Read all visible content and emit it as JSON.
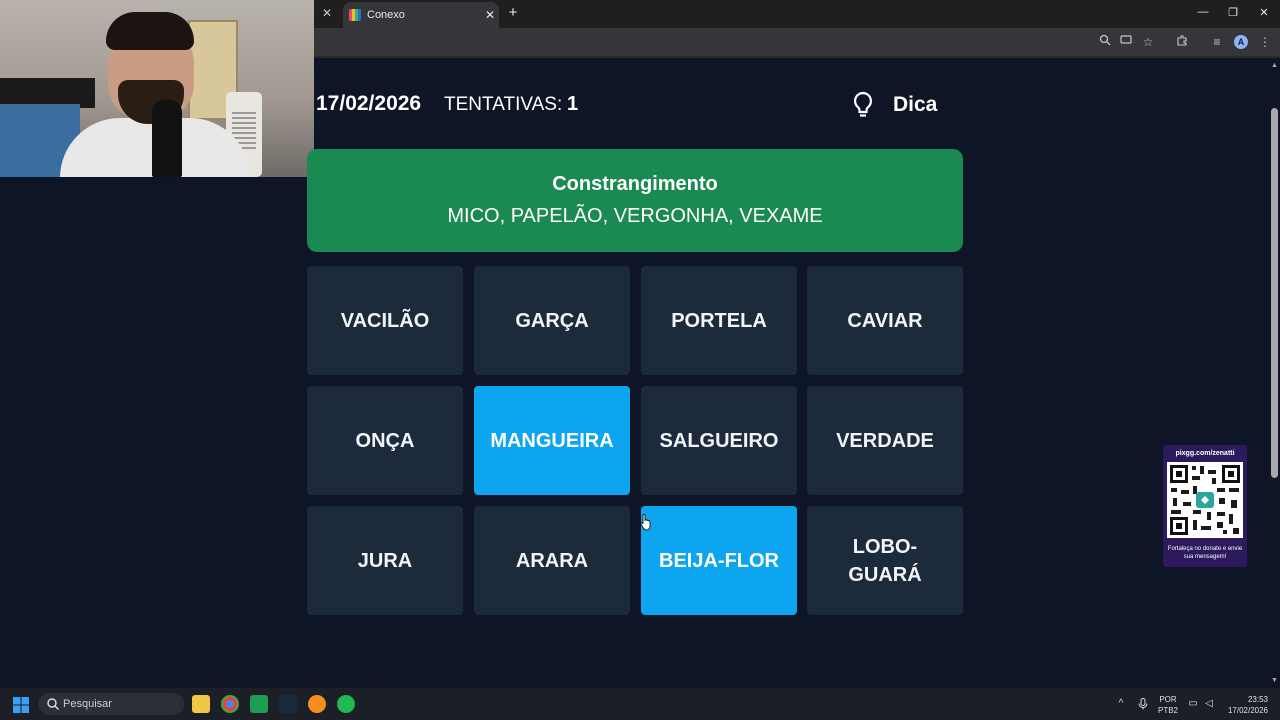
{
  "browser": {
    "tab_title": "Conexo",
    "tab_close": "✕",
    "prev_tab_close": "✕",
    "new_tab": "+",
    "minimize": "—",
    "restore": "❐",
    "close": "✕",
    "profile_initial": "A"
  },
  "game": {
    "date": "17/02/2026",
    "attempts_label": "TENTATIVAS:",
    "attempts_value": "1",
    "hint_label": "Dica",
    "solved_group": {
      "title": "Constrangimento",
      "words": "MICO, PAPELÃO, VERGONHA, VEXAME",
      "color": "#1a8a52"
    },
    "cards": [
      {
        "label": "VACILÃO",
        "selected": false
      },
      {
        "label": "GARÇA",
        "selected": false
      },
      {
        "label": "PORTELA",
        "selected": false
      },
      {
        "label": "CAVIAR",
        "selected": false
      },
      {
        "label": "ONÇA",
        "selected": false
      },
      {
        "label": "MANGUEIRA",
        "selected": true
      },
      {
        "label": "SALGUEIRO",
        "selected": false
      },
      {
        "label": "VERDADE",
        "selected": false
      },
      {
        "label": "JURA",
        "selected": false
      },
      {
        "label": "ARARA",
        "selected": false
      },
      {
        "label": "BEIJA-FLOR",
        "selected": true
      },
      {
        "label": "LOBO-GUARÁ",
        "selected": false
      }
    ],
    "selected_color": "#0ea5f0"
  },
  "donation_widget": {
    "url": "pixgg.com/zenatti",
    "message": "Fortaleça no donate e envie sua mensagem!"
  },
  "taskbar": {
    "search_placeholder": "Pesquisar",
    "language_line1": "POR",
    "language_line2": "PTB2",
    "time": "23:53",
    "date": "17/02/2026"
  }
}
